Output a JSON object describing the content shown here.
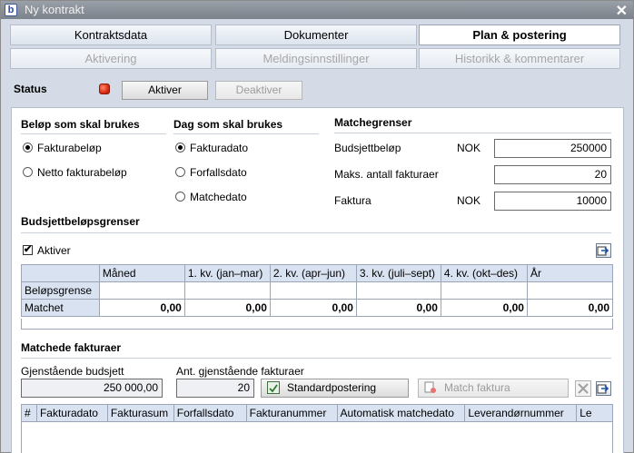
{
  "window": {
    "title": "Ny kontrakt",
    "app_icon": "b",
    "close_glyph": "✕"
  },
  "tabs_row1": [
    {
      "label": "Kontraktsdata",
      "state": "normal"
    },
    {
      "label": "Dokumenter",
      "state": "normal"
    },
    {
      "label": "Plan & postering",
      "state": "active"
    }
  ],
  "tabs_row2": [
    {
      "label": "Aktivering",
      "state": "disabled"
    },
    {
      "label": "Meldingsinnstillinger",
      "state": "disabled"
    },
    {
      "label": "Historikk & kommentarer",
      "state": "disabled"
    }
  ],
  "status": {
    "label": "Status",
    "indicator_color": "#d3200a",
    "activate_button": "Aktiver",
    "deactivate_button": "Deaktiver"
  },
  "amount_section": {
    "title": "Beløp som skal brukes",
    "options": [
      "Fakturabeløp",
      "Netto fakturabeløp"
    ],
    "selected": 0
  },
  "date_section": {
    "title": "Dag som skal brukes",
    "options": [
      "Fakturadato",
      "Forfallsdato",
      "Matchedato"
    ],
    "selected": 0
  },
  "match_limits": {
    "title": "Matchegrenser",
    "rows": [
      {
        "label": "Budsjettbeløp",
        "currency": "NOK",
        "value": "250000"
      },
      {
        "label": "Maks. antall fakturaer",
        "currency": "",
        "value": "20"
      },
      {
        "label": "Faktura",
        "currency": "NOK",
        "value": "10000"
      }
    ]
  },
  "budget_limits": {
    "title": "Budsjettbeløpsgrenser",
    "activate_label": "Aktiver",
    "activate_checked": true,
    "check_glyph": "✔",
    "columns": [
      "",
      "Måned",
      "1. kv. (jan–mar)",
      "2. kv. (apr–jun)",
      "3. kv. (juli–sept)",
      "4. kv. (okt–des)",
      "År"
    ],
    "rows": [
      {
        "label": "Beløpsgrense",
        "values": [
          "",
          "",
          "",
          "",
          "",
          ""
        ]
      },
      {
        "label": "Matchet",
        "values": [
          "0,00",
          "0,00",
          "0,00",
          "0,00",
          "0,00",
          "0,00"
        ]
      }
    ]
  },
  "matched_invoices": {
    "title": "Matchede fakturaer",
    "remaining_budget_label": "Gjenstående budsjett",
    "remaining_budget_value": "250 000,00",
    "remaining_count_label": "Ant. gjenstående fakturaer",
    "remaining_count_value": "20",
    "standard_posting_button": "Standardpostering",
    "match_invoice_button": "Match faktura",
    "columns": [
      "#",
      "Fakturadato",
      "Fakturasum",
      "Forfallsdato",
      "Fakturanummer",
      "Automatisk matchedato",
      "Leverandørnummer",
      "Le"
    ]
  }
}
